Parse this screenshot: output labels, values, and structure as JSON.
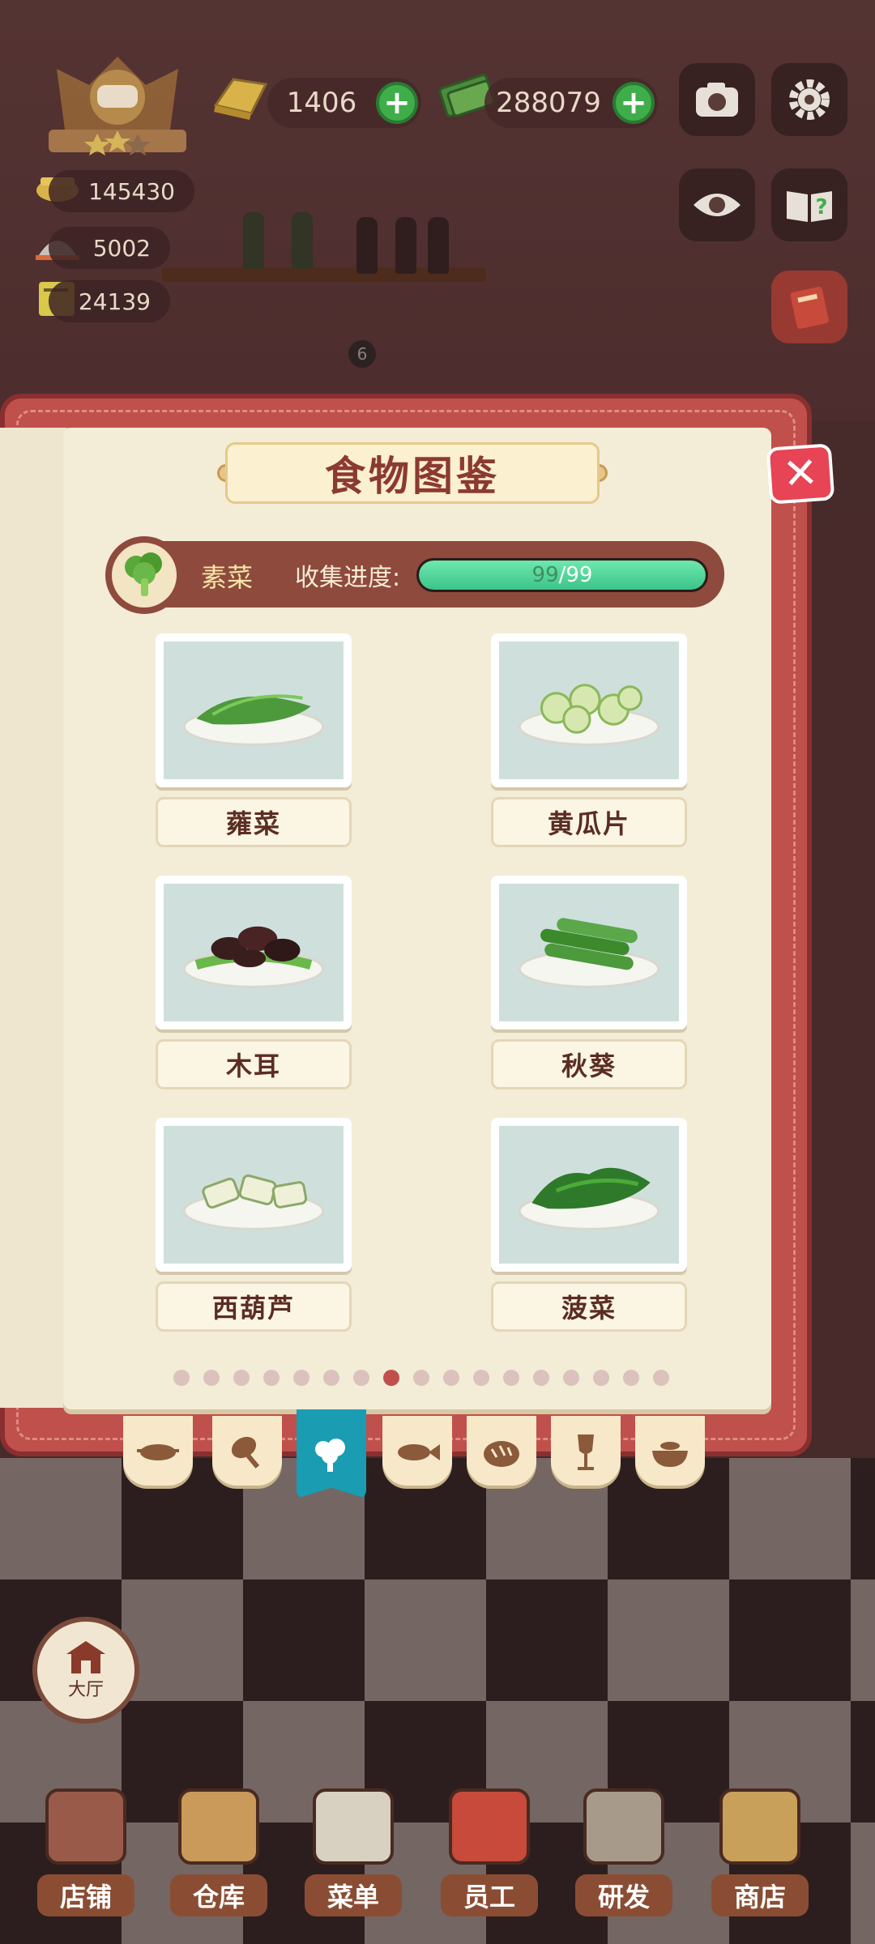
{
  "hud": {
    "gold_bars": "1406",
    "cash": "288079",
    "stat_1": "145430",
    "stat_2": "5002",
    "stat_3": "24139",
    "shelf_badge": "6"
  },
  "panel": {
    "title": "食物图鉴",
    "category_name": "素菜",
    "progress_label": "收集进度:",
    "progress_current": "99",
    "progress_total": "/99",
    "progress_fraction": 1.0
  },
  "foods": [
    {
      "name": "蕹菜",
      "icon": "water-spinach-dish"
    },
    {
      "name": "黄瓜片",
      "icon": "cucumber-slices-dish"
    },
    {
      "name": "木耳",
      "icon": "wood-ear-dish"
    },
    {
      "name": "秋葵",
      "icon": "okra-dish"
    },
    {
      "name": "西葫芦",
      "icon": "zucchini-dish"
    },
    {
      "name": "菠菜",
      "icon": "spinach-dish"
    }
  ],
  "pagination": {
    "total": 17,
    "active_index": 7
  },
  "category_tabs": [
    "wok-icon",
    "drumstick-icon",
    "broccoli-icon",
    "fish-icon",
    "bread-icon",
    "wine-glass-icon",
    "soup-bowl-icon"
  ],
  "active_tab": 2,
  "hall_label": "大厅",
  "bottom_nav": [
    "店铺",
    "仓库",
    "菜单",
    "员工",
    "研发",
    "商店"
  ],
  "colors": {
    "accent_red": "#c0504b",
    "progress_green": "#3cc48a",
    "active_tab": "#1a9cb2"
  }
}
